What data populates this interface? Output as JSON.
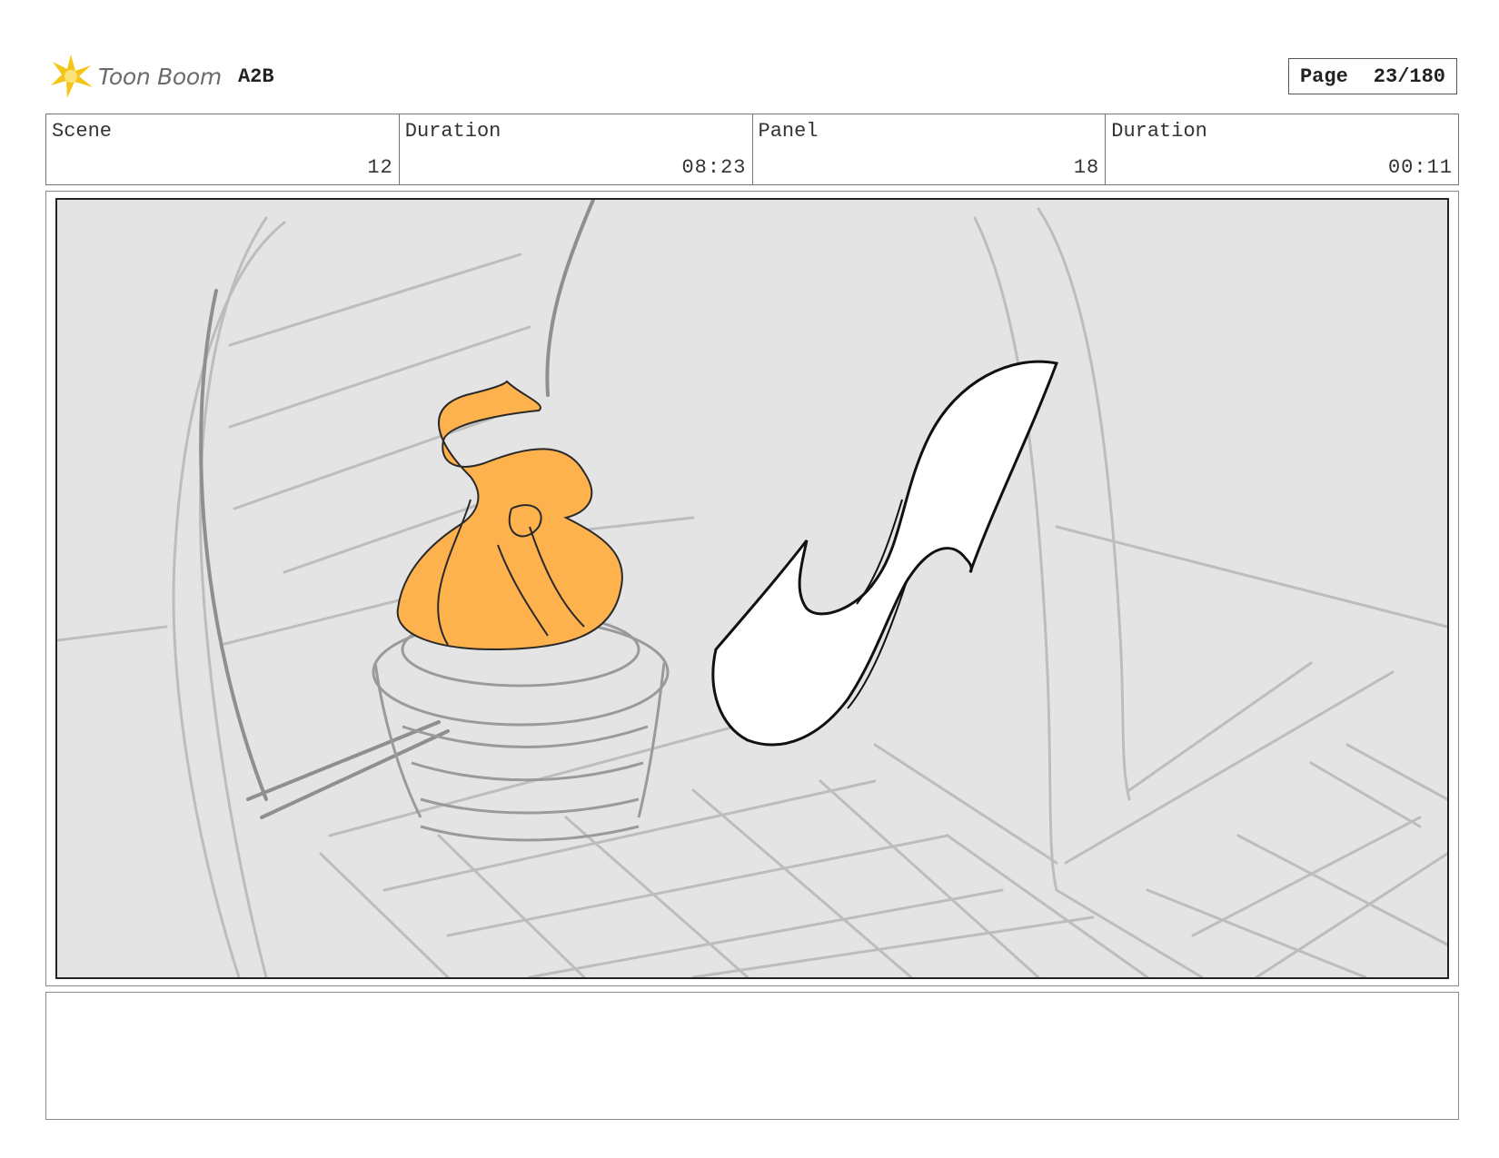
{
  "header": {
    "brand": "Toon Boom",
    "project": "A2B",
    "page_label": "Page",
    "page_value": "23/180"
  },
  "info": {
    "scene_label": "Scene",
    "scene_value": "12",
    "scene_duration_label": "Duration",
    "scene_duration_value": "08:23",
    "panel_label": "Panel",
    "panel_value": "18",
    "panel_duration_label": "Duration",
    "panel_duration_value": "00:11"
  },
  "icons": {
    "logo": "toon-boom-burst-icon"
  },
  "colors": {
    "flame": "#fdb24d",
    "logo": "#f5c518",
    "panel_bg": "#e4e4e4"
  }
}
